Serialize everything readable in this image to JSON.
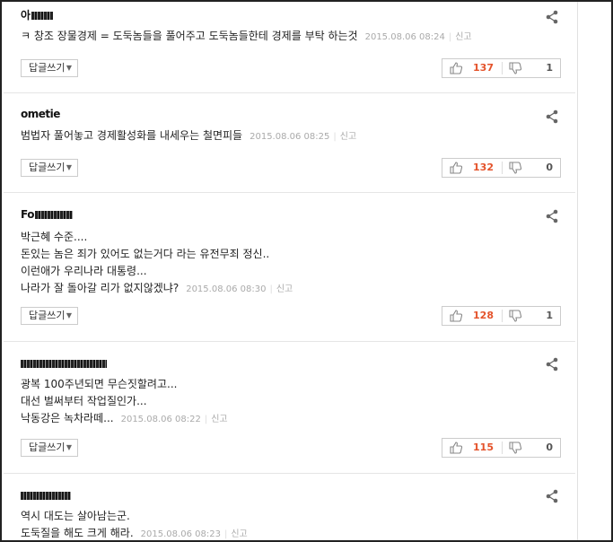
{
  "comments": [
    {
      "author": "아",
      "lines": [
        "ㅋ 창조 장물경제 = 도둑놈들을 풀어주고 도둑놈들한테 경제를 부탁 하는것"
      ],
      "timestamp": "2015.08.06 08:24",
      "report": "신고",
      "reply": "답글쓰기",
      "likes": "137",
      "dislikes": "1"
    },
    {
      "author": "ometie",
      "lines": [
        "범법자 풀어놓고 경제활성화를 내세우는 철면피들"
      ],
      "timestamp": "2015.08.06 08:25",
      "report": "신고",
      "reply": "답글쓰기",
      "likes": "132",
      "dislikes": "0"
    },
    {
      "author": "Fo",
      "lines": [
        "박근혜 수준....",
        "돈있는 놈은 죄가 있어도 없는거다 라는 유전무죄 정신..",
        "이런애가 우리나라 대통령...",
        "나라가 잘 돌아갈 리가 없지않겠냐?"
      ],
      "timestamp": "2015.08.06 08:30",
      "report": "신고",
      "reply": "답글쓰기",
      "likes": "128",
      "dislikes": "1"
    },
    {
      "author": "",
      "lines": [
        "광복 100주년되면 무슨짓할려고...",
        "대선 벌써부터 작업질인가...",
        "낙동강은 녹차라떼..."
      ],
      "timestamp": "2015.08.06 08:22",
      "report": "신고",
      "reply": "답글쓰기",
      "likes": "115",
      "dislikes": "0"
    },
    {
      "author": "",
      "lines": [
        "역시 대도는 살아남는군.",
        "도둑질을 해도 크게 해라."
      ],
      "timestamp": "2015.08.06 08:23",
      "report": "신고",
      "reply": "",
      "likes": "",
      "dislikes": ""
    }
  ]
}
